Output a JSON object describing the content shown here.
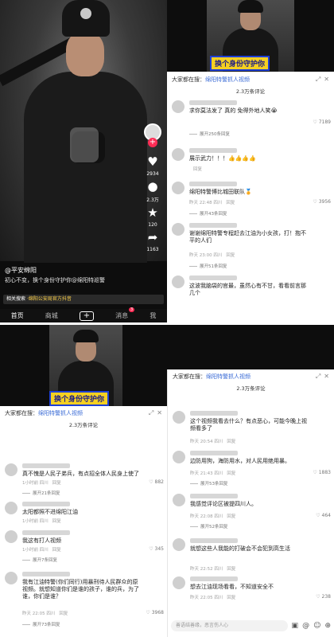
{
  "panel_a": {
    "rail": {
      "like_count": "2934",
      "comment_count": "2.3万",
      "star_count": "120",
      "share_count": "1163"
    },
    "author": "@平安绵阳",
    "description": "初心不变，换个身份守护你@绵阳特巡警",
    "search": {
      "prefix": "相关搜索",
      "query": "·绵阳公安局官方抖音"
    },
    "nav": {
      "home": "首页",
      "mall": "商城",
      "messages": "消息",
      "messages_badge": "3",
      "me": "我"
    }
  },
  "sticker_text": "换个身份守护你",
  "panel_b": {
    "header": "大家都在搜：",
    "header_link": "绵阳特警抓人视频",
    "count": "2.3万条评论",
    "comments": [
      {
        "text": "求你莫法发了 真的 免得外地人笑😭",
        "meta": "",
        "reply": "",
        "likes": "7189",
        "expand": "展开250条回复"
      },
      {
        "text": "展示武力！！！👍👍👍👍",
        "meta": "",
        "reply": "回复",
        "likes": "",
        "expand": ""
      },
      {
        "text": "绵阳特警博比城田联队🏅",
        "meta": "昨天 22:48 四川",
        "reply": "回复",
        "likes": "3956",
        "expand": "展开43条回复"
      },
      {
        "text": "谢谢绵阳特警专程赶去江油为小女孩，打！抱不平的人们",
        "meta": "昨天 23:00 四川",
        "reply": "回复",
        "likes": "",
        "expand": "展开51条回复"
      },
      {
        "text": "这波我脑袋的官最，虽然心有不甘，看看前言那几个",
        "meta": "",
        "reply": "",
        "likes": "",
        "expand": ""
      }
    ]
  },
  "panel_c": {
    "header": "大家都在搜：",
    "header_link": "绵阳特警抓人视频",
    "count": "2.3万条评论",
    "comments": [
      {
        "text": "真不愧是人民子弟兵，有点招全体人民身上使了",
        "meta": "1小时前 四川",
        "reply": "回复",
        "likes": "882",
        "expand": "展开21条回复"
      },
      {
        "text": "太阳都照不进绵阳江油",
        "meta": "1小时前 四川",
        "reply": "回复",
        "likes": "",
        "expand": ""
      },
      {
        "text": "我这有打人视频",
        "meta": "1小时前 四川",
        "reply": "回复",
        "likes": "345",
        "expand": "展开7条回复"
      },
      {
        "text": "我有江油特警(你们同行)用暴刑待人民群众的原视频。就想知道你们是谁的孩子，谁的兵，为了谁，你们是谁？",
        "meta": "昨天 22:05 四川",
        "reply": "回复",
        "likes": "3968",
        "expand": "展开73条回复"
      }
    ]
  },
  "panel_d": {
    "header": "大家都在搜：",
    "header_link": "绵阳特警抓人视频",
    "count": "2.3万条评论",
    "comments": [
      {
        "text": "这个视频我看去什么？有点恶心，可能今晚上视频看多了",
        "meta": "昨天 20:54 四川",
        "reply": "回复",
        "likes": "",
        "expand": ""
      },
      {
        "text": "边防用狗，海防用水，对人民用绝用暴。",
        "meta": "昨天 21:43 四川",
        "reply": "回复",
        "likes": "1883",
        "expand": "展开53条回复"
      },
      {
        "text": "我感觉评论区被提四川人。",
        "meta": "昨天 22:08 四川",
        "reply": "回复",
        "likes": "464",
        "expand": "展开52条回复"
      },
      {
        "text": "就想这些人我能的打破会不会犯到高生活",
        "meta": "昨天 22:52 四川",
        "reply": "回复",
        "likes": "",
        "expand": ""
      },
      {
        "text": "想去江油现场看看，不知道安全不",
        "meta": "昨天 22:05 四川",
        "reply": "回复",
        "likes": "238",
        "expand": ""
      }
    ],
    "input_placeholder": "善语结善缘，恶言伤人心"
  }
}
